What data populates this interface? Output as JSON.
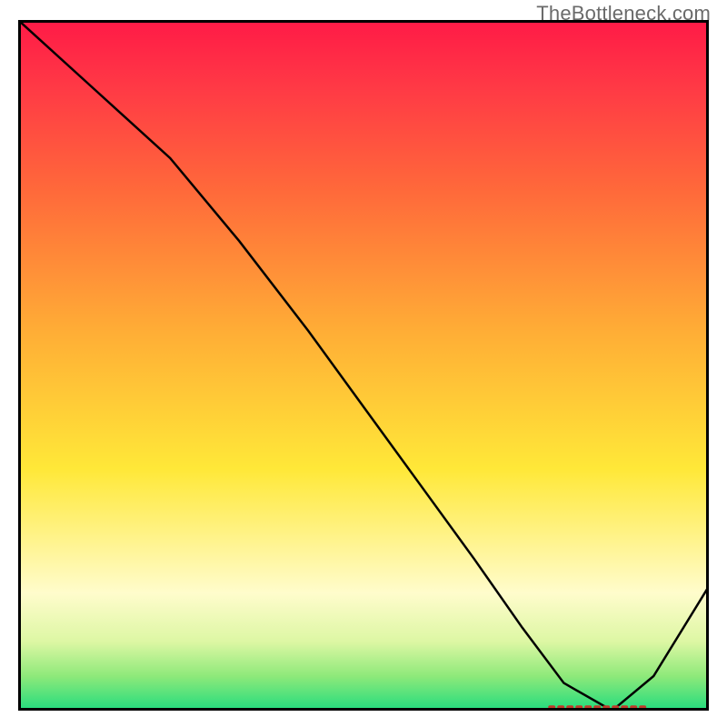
{
  "attribution": "TheBottleneck.com",
  "chart_data": {
    "type": "line",
    "title": "",
    "xlabel": "",
    "ylabel": "",
    "xlim": [
      0,
      100
    ],
    "ylim": [
      0,
      100
    ],
    "series": [
      {
        "name": "curve",
        "x": [
          0,
          11,
          22,
          32,
          42,
          50,
          58,
          66,
          73,
          79,
          86,
          92,
          100
        ],
        "values": [
          100,
          90,
          80,
          68,
          55,
          44,
          33,
          22,
          12,
          4,
          0,
          5,
          18
        ]
      }
    ],
    "annotations": [
      {
        "name": "optimal-range-marker",
        "y": 0.5,
        "x_start": 77,
        "x_end": 91
      }
    ],
    "background_gradient": {
      "top_color": "#ff1a47",
      "mid_color": "#ffe838",
      "bottom_color": "#22dc7e"
    }
  }
}
